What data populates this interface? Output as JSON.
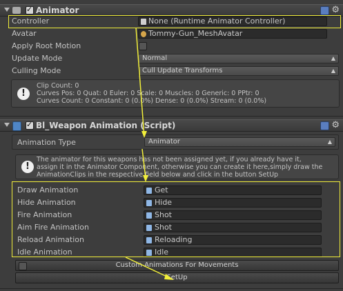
{
  "animator": {
    "title": "Animator",
    "fields": [
      {
        "label": "Controller",
        "value": "None (Runtime Animator Controller)"
      },
      {
        "label": "Avatar",
        "value": "Tommy-Gun_MeshAvatar"
      },
      {
        "label": "Apply Root Motion"
      },
      {
        "label": "Update Mode",
        "value": "Normal"
      },
      {
        "label": "Culling Mode",
        "value": "Cull Update Transforms"
      }
    ],
    "info": [
      "Clip Count: 0",
      "Curves Pos: 0 Quat: 0 Euler: 0 Scale: 0 Muscles: 0 Generic: 0 PPtr: 0",
      "Curves Count: 0 Constant: 0 (0.0%) Dense: 0 (0.0%) Stream: 0 (0.0%)"
    ]
  },
  "script": {
    "title": "Bl_Weapon Animation (Script)",
    "anim_type_label": "Animation Type",
    "anim_type_value": "Animator",
    "help_lines": [
      "The animator for this weapons has not been assigned yet, if you already have it,",
      "assign it in the Animator Component, otherwise you can create it here,simply draw the",
      "AnimationClips in the respective field below and click in the button SetUp"
    ],
    "clips": [
      {
        "label": "Draw Animation",
        "value": "Get"
      },
      {
        "label": "Hide Animation",
        "value": "Hide"
      },
      {
        "label": "Fire Animation",
        "value": "Shot"
      },
      {
        "label": "Aim Fire Animation",
        "value": "Shot"
      },
      {
        "label": "Reload Animation",
        "value": "Reloading"
      },
      {
        "label": "Idle Animation",
        "value": "Idle"
      }
    ],
    "custom_button": "Custom Animations For Movements",
    "setup_button": "SetUp"
  },
  "colors": {
    "annotation": "#f2ef3a",
    "panel": "#3d3d3d"
  }
}
